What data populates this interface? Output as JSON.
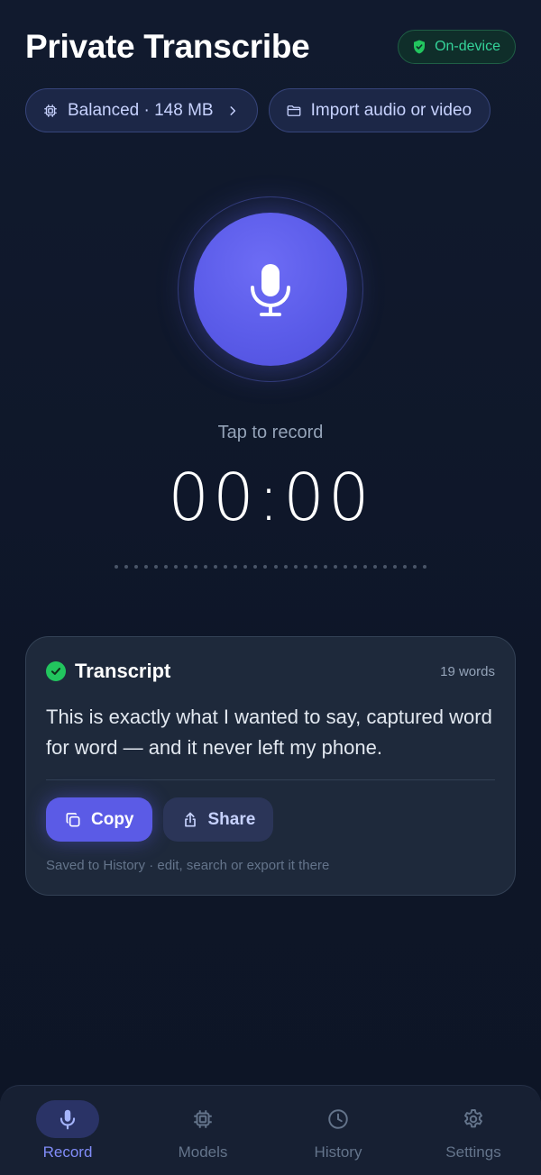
{
  "header": {
    "title": "Private Transcribe",
    "badge": "On-device",
    "badge_color": "#34d399"
  },
  "chips": {
    "model": "Balanced · 148 MB",
    "import": "Import audio or video"
  },
  "recorder": {
    "hint": "Tap to record",
    "timer": "00:00",
    "accent": "#5b5ce9"
  },
  "transcript": {
    "title": "Transcript",
    "word_count": "19 words",
    "text": "This is exactly what I wanted to say, captured word for word — and it never left my phone.",
    "copy_label": "Copy",
    "share_label": "Share",
    "saved_note": "Saved to History · edit, search or export it there"
  },
  "nav": {
    "items": [
      {
        "label": "Record",
        "icon": "mic-icon",
        "active": true
      },
      {
        "label": "Models",
        "icon": "chip-icon",
        "active": false
      },
      {
        "label": "History",
        "icon": "clock-icon",
        "active": false
      },
      {
        "label": "Settings",
        "icon": "gear-icon",
        "active": false
      }
    ]
  }
}
